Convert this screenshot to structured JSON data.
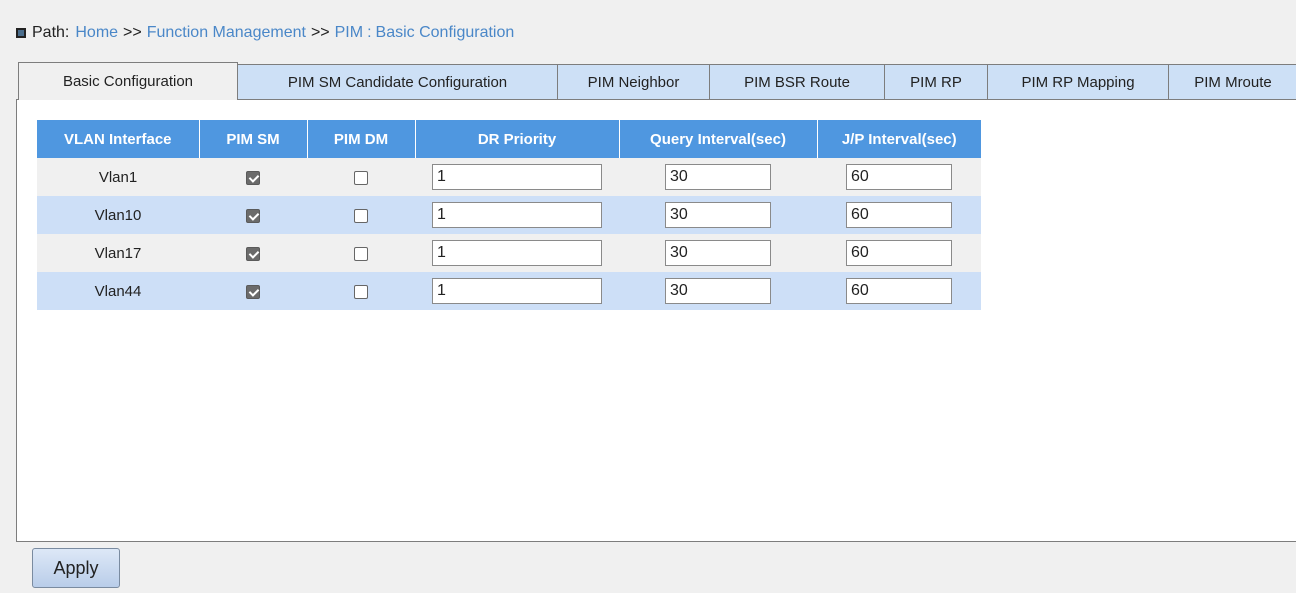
{
  "breadcrumb": {
    "label": "Path:",
    "items": [
      "Home",
      "Function Management",
      "PIM"
    ],
    "separator": ">>",
    "current_separator": ":",
    "current": "Basic Configuration"
  },
  "tabs": [
    {
      "label": "Basic Configuration",
      "active": true
    },
    {
      "label": "PIM SM Candidate Configuration",
      "active": false
    },
    {
      "label": "PIM Neighbor",
      "active": false
    },
    {
      "label": "PIM BSR Route",
      "active": false
    },
    {
      "label": "PIM RP",
      "active": false
    },
    {
      "label": "PIM RP Mapping",
      "active": false
    },
    {
      "label": "PIM Mroute",
      "active": false
    }
  ],
  "table": {
    "headers": [
      "VLAN Interface",
      "PIM SM",
      "PIM DM",
      "DR Priority",
      "Query Interval(sec)",
      "J/P Interval(sec)"
    ],
    "rows": [
      {
        "vlan": "Vlan1",
        "pim_sm": true,
        "pim_dm": false,
        "dr_priority": "1",
        "query_interval": "30",
        "jp_interval": "60"
      },
      {
        "vlan": "Vlan10",
        "pim_sm": true,
        "pim_dm": false,
        "dr_priority": "1",
        "query_interval": "30",
        "jp_interval": "60"
      },
      {
        "vlan": "Vlan17",
        "pim_sm": true,
        "pim_dm": false,
        "dr_priority": "1",
        "query_interval": "30",
        "jp_interval": "60"
      },
      {
        "vlan": "Vlan44",
        "pim_sm": true,
        "pim_dm": false,
        "dr_priority": "1",
        "query_interval": "30",
        "jp_interval": "60"
      }
    ]
  },
  "apply_label": "Apply",
  "colors": {
    "header_bg": "#4f97e0",
    "row_alt": "#cddff7",
    "link": "#4a87c8",
    "tab_bg": "#cde0f6"
  }
}
